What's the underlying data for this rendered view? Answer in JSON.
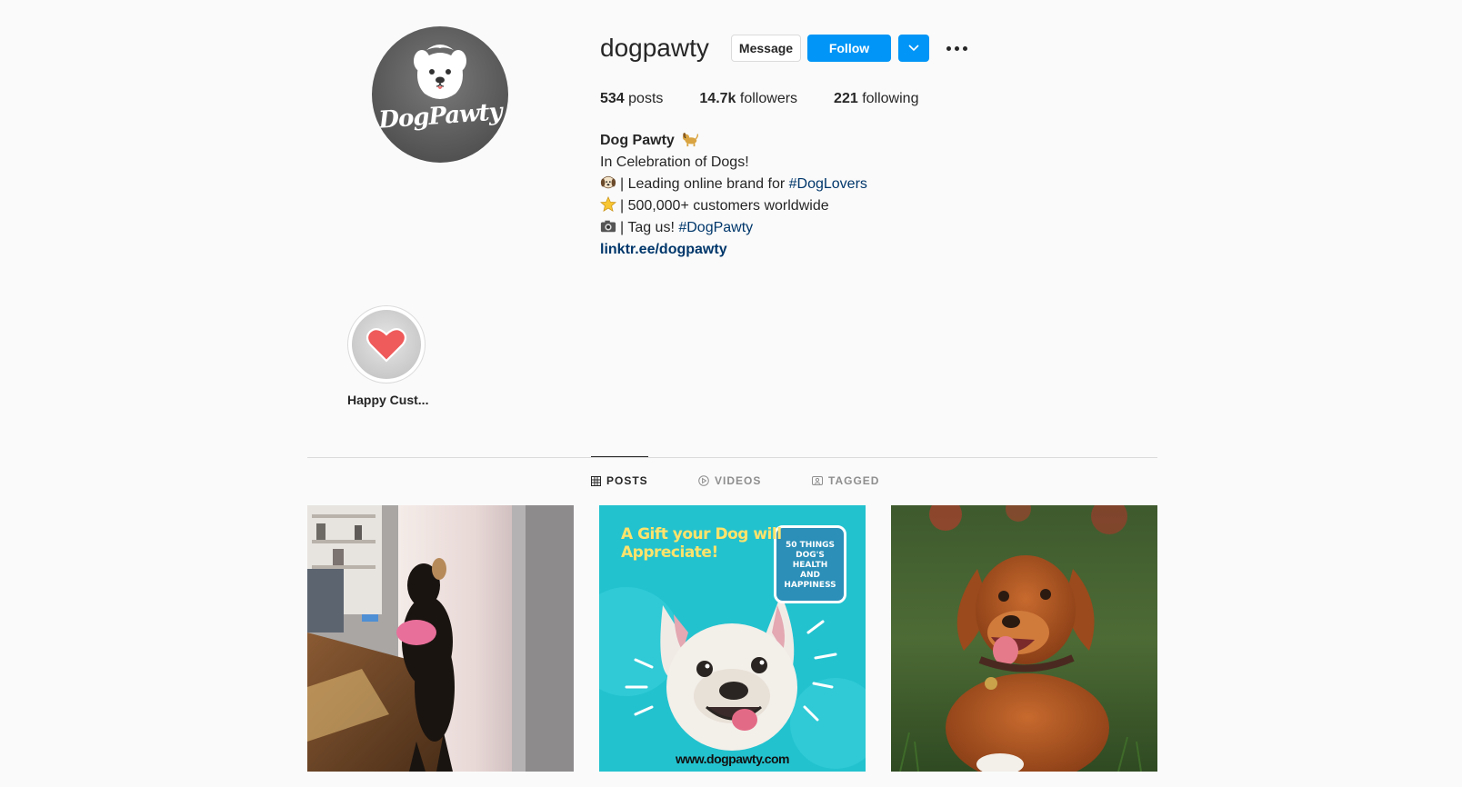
{
  "profile": {
    "username": "dogpawty",
    "avatar_logo_text": "DogPawty",
    "buttons": {
      "message": "Message",
      "follow": "Follow"
    },
    "stats": {
      "posts_count": "534",
      "posts_label": "posts",
      "followers_count": "14.7k",
      "followers_label": "followers",
      "following_count": "221",
      "following_label": "following"
    },
    "bio": {
      "name": "Dog Pawty",
      "tagline": "In Celebration of Dogs!",
      "line1_text": "| Leading online brand for ",
      "line1_hashtag": "#DogLovers",
      "line2_text": "| 500,000+ customers worldwide",
      "line3_text": "| Tag us! ",
      "line3_hashtag": "#DogPawty",
      "link": "linktr.ee/dogpawty"
    }
  },
  "highlights": [
    {
      "label": "Happy Cust...",
      "icon": "heart-icon"
    }
  ],
  "tabs": [
    {
      "label": "POSTS",
      "icon": "grid-icon",
      "active": true
    },
    {
      "label": "VIDEOS",
      "icon": "play-icon",
      "active": false
    },
    {
      "label": "TAGGED",
      "icon": "tag-icon",
      "active": false
    }
  ],
  "posts": [
    {
      "subject": "dog looking out window"
    },
    {
      "subject": "gift book promotion",
      "headline_line1": "A Gift your Dog will",
      "headline_line2": "Appreciate!",
      "book_title": "50 THINGS DOG'S HEALTH AND HAPPINESS",
      "url": "www.dogpawty.com"
    },
    {
      "subject": "brown dog in grass"
    }
  ],
  "colors": {
    "accent": "#0095f6",
    "link": "#00376b",
    "background": "#fafafa",
    "post2_bg": "#23c2cf",
    "headline": "#ffe36b"
  }
}
